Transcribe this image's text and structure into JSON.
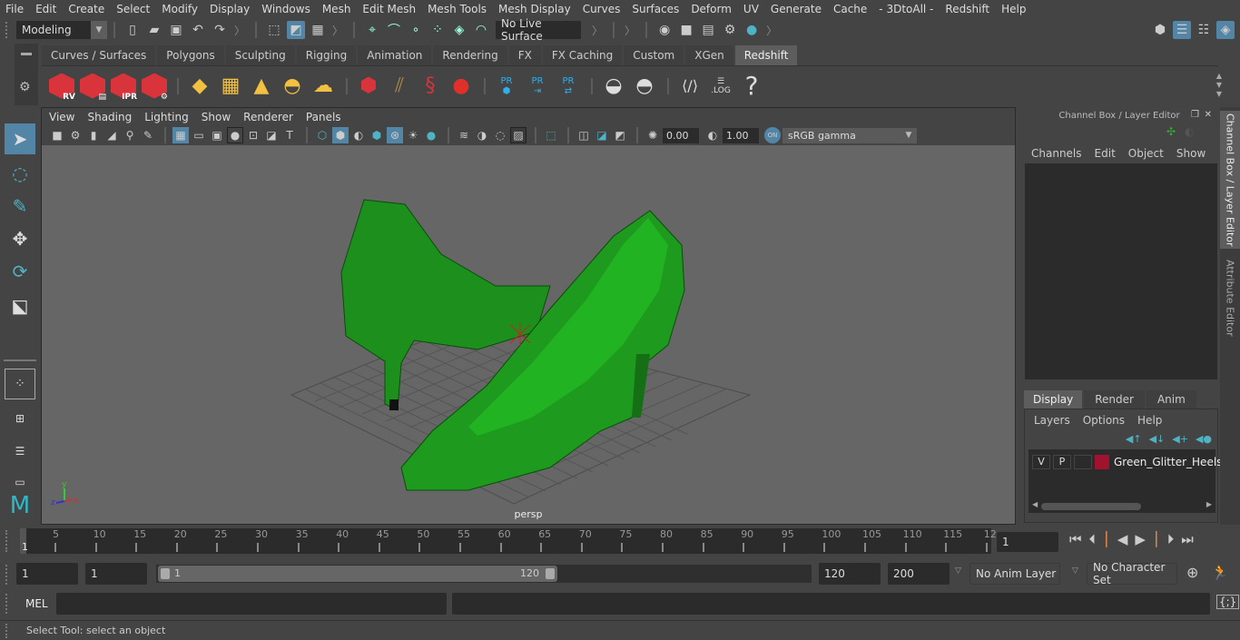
{
  "menu": [
    "File",
    "Edit",
    "Create",
    "Select",
    "Modify",
    "Display",
    "Windows",
    "Mesh",
    "Edit Mesh",
    "Mesh Tools",
    "Mesh Display",
    "Curves",
    "Surfaces",
    "Deform",
    "UV",
    "Generate",
    "Cache",
    "- 3DtoAll -",
    "Redshift",
    "Help"
  ],
  "statusline": {
    "mode": "Modeling",
    "live_surface": "No Live Surface"
  },
  "shelf_tabs": [
    "Curves / Surfaces",
    "Polygons",
    "Sculpting",
    "Rigging",
    "Animation",
    "Rendering",
    "FX",
    "FX Caching",
    "Custom",
    "XGen",
    "Redshift"
  ],
  "shelf_active": "Redshift",
  "shelf_labels": {
    "rv": "RV",
    "ipr": "IPR",
    "pr": "PR",
    "log": ".LOG",
    "help": "?"
  },
  "viewport": {
    "menu": [
      "View",
      "Shading",
      "Lighting",
      "Show",
      "Renderer",
      "Panels"
    ],
    "exposure": "0.00",
    "gamma": "1.00",
    "color_mgmt": "ON",
    "color_space": "sRGB gamma",
    "camera": "persp",
    "axis": {
      "x": "x",
      "y": "y",
      "z": "z"
    }
  },
  "channel_box": {
    "title": "Channel Box / Layer Editor",
    "menu": [
      "Channels",
      "Edit",
      "Object",
      "Show"
    ]
  },
  "layer_editor": {
    "tabs": [
      "Display",
      "Render",
      "Anim"
    ],
    "active_tab": "Display",
    "menu": [
      "Layers",
      "Options",
      "Help"
    ],
    "layers": [
      {
        "v": "V",
        "p": "P",
        "color": "#a0122e",
        "name": "Green_Glitter_Heels"
      }
    ]
  },
  "side_tabs": [
    "Channel Box / Layer Editor",
    "Attribute Editor"
  ],
  "timeline": {
    "ticks": [
      "5",
      "10",
      "15",
      "20",
      "25",
      "30",
      "35",
      "40",
      "45",
      "50",
      "55",
      "60",
      "65",
      "70",
      "75",
      "80",
      "85",
      "90",
      "95",
      "100",
      "105",
      "110",
      "115",
      "12"
    ],
    "current_frame_marker": "1",
    "current_frame": "1"
  },
  "range": {
    "start": "1",
    "playback_start": "1",
    "slider_start": "1",
    "slider_end": "120",
    "playback_end": "120",
    "end": "200",
    "anim_layer": "No Anim Layer",
    "character_set": "No Character Set"
  },
  "command_line": {
    "label": "MEL",
    "value": ""
  },
  "help_line": "Select Tool: select an object"
}
